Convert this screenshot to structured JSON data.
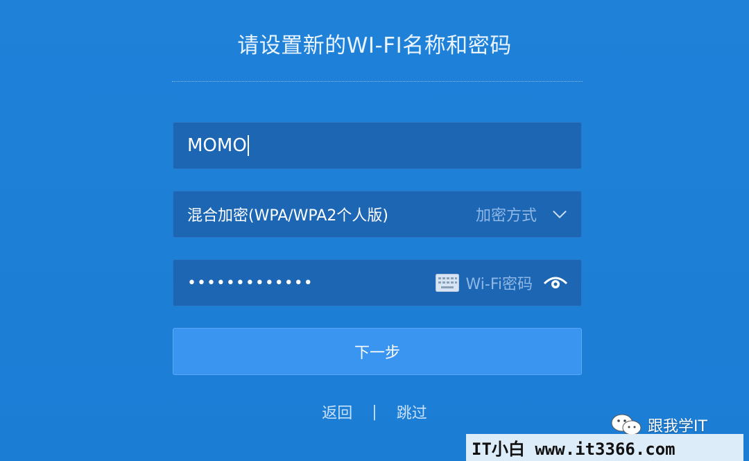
{
  "page": {
    "title": "请设置新的WI-FI名称和密码"
  },
  "ssid": {
    "value": "MOMO"
  },
  "encryption": {
    "selected": "混合加密(WPA/WPA2个人版)",
    "label": "加密方式",
    "icon": "chevron-down-icon"
  },
  "password": {
    "masked_value": "•••••••••••••",
    "label": "Wi-Fi密码",
    "keyboard_icon": "keyboard-icon",
    "visibility_icon": "eye-icon"
  },
  "next_button": {
    "label": "下一步"
  },
  "footer_links": {
    "back": "返回",
    "separator": "|",
    "skip": "跳过"
  },
  "watermark": {
    "account": "跟我学IT",
    "site": "IT小白  www.it3366.com"
  },
  "colors": {
    "background": "#1f81d8",
    "field_bg": "#1c66b4",
    "button_bg": "#3a95f1",
    "hint_text": "#8fb8e6"
  }
}
